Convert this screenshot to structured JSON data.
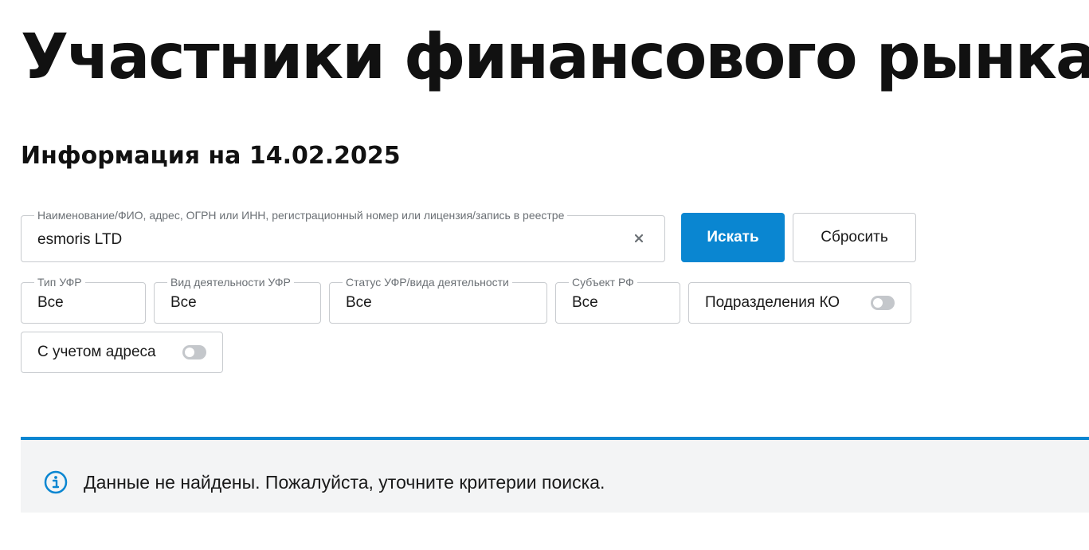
{
  "page": {
    "title": "Участники финансового рынка",
    "info_date": "Информация на 14.02.2025"
  },
  "search": {
    "label": "Наименование/ФИО, адрес, ОГРН или ИНН, регистрационный номер или лицензия/запись в реестре",
    "value": "esmoris LTD",
    "clear_icon": "close-icon",
    "search_button": "Искать",
    "reset_button": "Сбросить"
  },
  "filters": [
    {
      "label": "Тип УФР",
      "value": "Все"
    },
    {
      "label": "Вид деятельности УФР",
      "value": "Все"
    },
    {
      "label": "Статус УФР/вида деятельности",
      "value": "Все"
    },
    {
      "label": "Субъект РФ",
      "value": "Все"
    }
  ],
  "toggles": {
    "ko_divisions": {
      "label": "Подразделения КО",
      "on": false
    },
    "with_address": {
      "label": "С учетом адреса",
      "on": false
    }
  },
  "notice": {
    "icon": "info-icon",
    "text": "Данные не найдены. Пожалуйста, уточните критерии поиска."
  },
  "colors": {
    "accent": "#0a86d1",
    "border": "#c8cbcf",
    "notice_background": "#f3f4f5",
    "toggle_off": "#c4c7cb"
  }
}
